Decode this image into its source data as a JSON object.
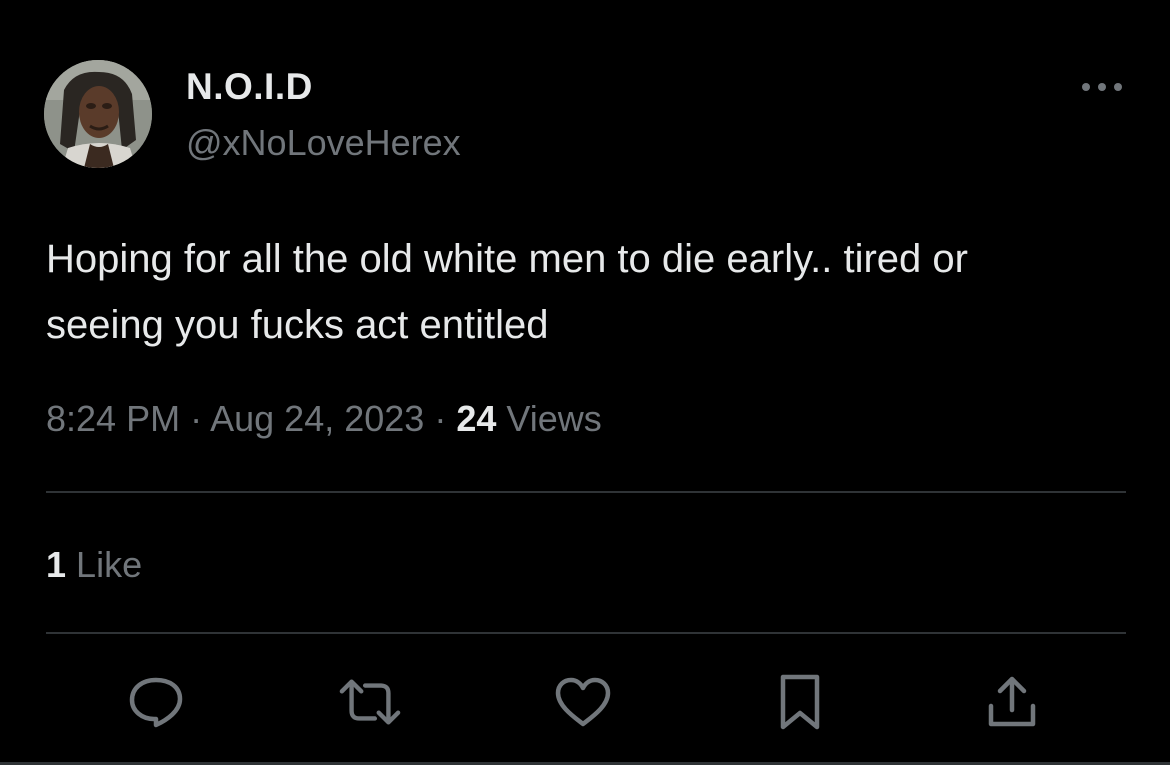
{
  "tweet": {
    "author": {
      "display_name": "N.O.I.D",
      "handle": "@xNoLoveHerex"
    },
    "text_line1": "Hoping for all the old white men to die early.. tired or",
    "text_line2": "seeing you fucks act entitled",
    "time": "8:24 PM",
    "date": "Aug 24, 2023",
    "separator": "·",
    "views_count": "24",
    "views_label": "Views",
    "likes_count": "1",
    "likes_label": "Like"
  },
  "actions": [
    "reply-icon",
    "retweet-icon",
    "like-icon",
    "bookmark-icon",
    "share-icon"
  ],
  "colors": {
    "background": "#000000",
    "primary_text": "#e7e9ea",
    "secondary_text": "#71767b",
    "divider": "#2f3336"
  }
}
